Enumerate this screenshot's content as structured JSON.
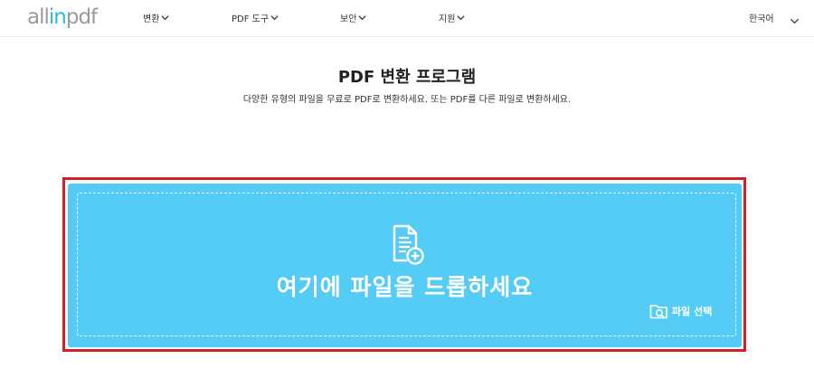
{
  "header": {
    "logo": {
      "part1": "all",
      "part2": "in",
      "part3": "pdf"
    },
    "nav": [
      {
        "label": "변환"
      },
      {
        "label": "PDF 도구"
      },
      {
        "label": "보안"
      },
      {
        "label": "지원"
      }
    ],
    "language": "한국어"
  },
  "main": {
    "title": "PDF 변환 프로그램",
    "subtitle": "다양한 유형의 파일을 무료로 PDF로 변환하세요. 또는 PDF를 다른 파일로 변환하세요.",
    "drop_zone": {
      "text": "여기에 파일을 드롭하세요",
      "select_label": "파일 선택"
    }
  },
  "colors": {
    "accent": "#27b7ef",
    "drop_zone_bg": "#55ccf6",
    "highlight_border": "#d31f26"
  }
}
